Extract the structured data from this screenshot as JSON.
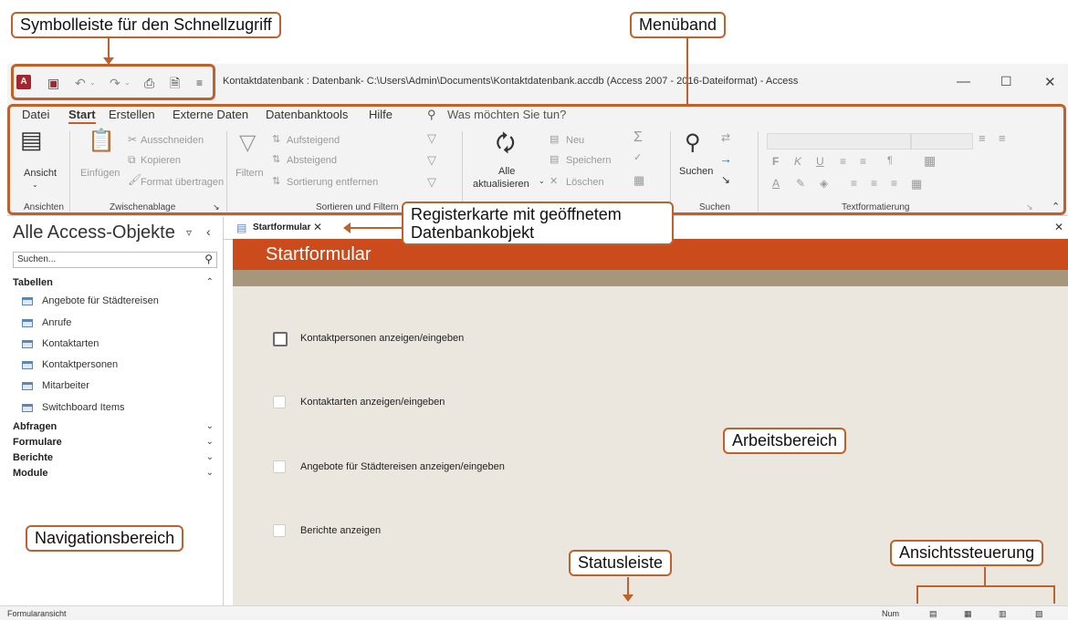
{
  "annotations": {
    "qat": "Symbolleiste für den Schnellzugriff",
    "ribbon": "Menüband",
    "tab": "Registerkarte mit geöffnetem Datenbankobjekt",
    "work": "Arbeitsbereich",
    "nav": "Navigationsbereich",
    "status": "Statusleiste",
    "views": "Ansichtssteuerung"
  },
  "window": {
    "title": "Kontaktdatenbank : Datenbank- C:\\Users\\Admin\\Documents\\Kontaktdatenbank.accdb (Access 2007 - 2016-Dateiformat)  -  Access"
  },
  "menu": {
    "items": [
      "Datei",
      "Start",
      "Erstellen",
      "Externe Daten",
      "Datenbanktools",
      "Hilfe"
    ],
    "search": "Was möchten Sie tun?"
  },
  "ribbon": {
    "ansicht": "Ansicht",
    "einfuegen": "Einfügen",
    "ausschneiden": "Ausschneiden",
    "kopieren": "Kopieren",
    "format": "Format übertragen",
    "filtern": "Filtern",
    "aufsteigend": "Aufsteigend",
    "absteigend": "Absteigend",
    "sortierung": "Sortierung entfernen",
    "alle": "Alle",
    "aktualisieren": "aktualisieren",
    "neu": "Neu",
    "speichern": "Speichern",
    "loeschen": "Löschen",
    "suchen": "Suchen",
    "groups": [
      "Ansichten",
      "Zwischenablage",
      "Sortieren und Filtern",
      "Suchen",
      "Textformatierung"
    ]
  },
  "nav": {
    "title": "Alle Access-Objekte",
    "search_placeholder": "Suchen...",
    "sections": {
      "tabellen": "Tabellen",
      "abfragen": "Abfragen",
      "formulare": "Formulare",
      "berichte": "Berichte",
      "module": "Module"
    },
    "tables": [
      "Angebote für Städtereisen",
      "Anrufe",
      "Kontaktarten",
      "Kontaktpersonen",
      "Mitarbeiter",
      "Switchboard Items"
    ]
  },
  "tab": {
    "label": "Startformular"
  },
  "form": {
    "header": "Startformular",
    "options": [
      "Kontaktpersonen anzeigen/eingeben",
      "Kontaktarten anzeigen/eingeben",
      "Angebote für Städtereisen anzeigen/eingeben",
      "Berichte anzeigen"
    ]
  },
  "statusbar": {
    "mode": "Formularansicht",
    "num": "Num"
  },
  "colors": {
    "accent": "#c0612b",
    "form_header": "#cc4b1c",
    "form_band": "#a6967c",
    "form_bg": "#ebe6de"
  },
  "icons": [
    "access-logo-icon",
    "save-icon",
    "undo-icon",
    "redo-icon",
    "print-icon",
    "close-icon",
    "minimize-icon",
    "maximize-icon",
    "search-icon",
    "table-icon",
    "form-view-icon",
    "datasheet-view-icon",
    "layout-view-icon",
    "design-view-icon"
  ]
}
